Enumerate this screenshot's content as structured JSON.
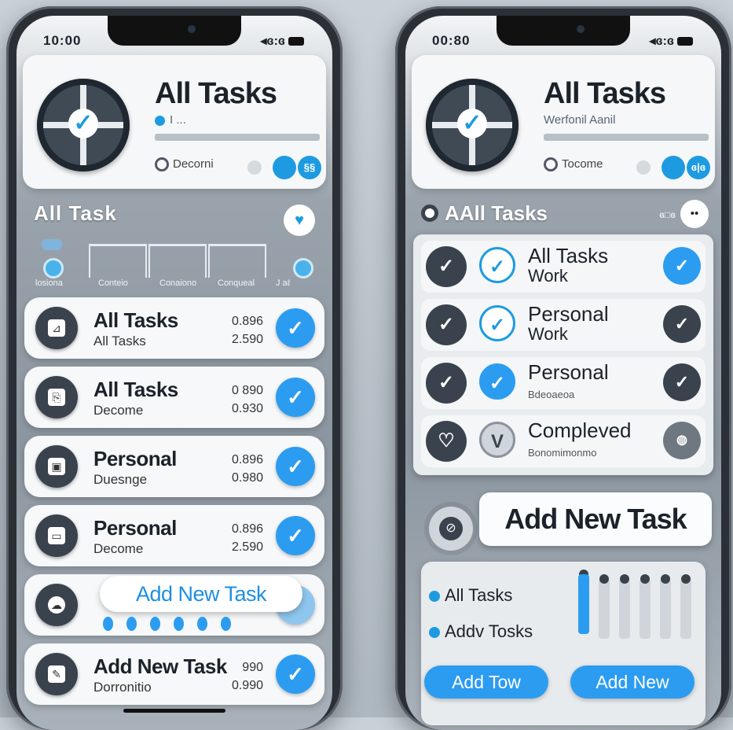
{
  "left": {
    "status": {
      "time": "10:00",
      "icons": "◂ɞ:ɞ"
    },
    "header": {
      "title": "All Tasks",
      "subtitle": "I ...",
      "chip": "Decorni",
      "btn1": "",
      "btn2": "§§"
    },
    "band": {
      "title": "All  Task",
      "labels": [
        "losiona",
        "Conteio",
        "Conaiono",
        "Conqueal",
        "J aℓ"
      ]
    },
    "rows": [
      {
        "title": "All Tasks",
        "sub": "All Tasks",
        "n1": "0.896",
        "n2": "2.590",
        "check": "✓"
      },
      {
        "title": "All Tasks",
        "sub": "Decome",
        "n1": "0 890",
        "n2": "0.930",
        "check": "✓"
      },
      {
        "title": "Personal",
        "sub": "Duesnge",
        "n1": "0.896",
        "n2": "0.980",
        "check": "✓"
      },
      {
        "title": "Personal",
        "sub": "Decome",
        "n1": "0.896",
        "n2": "2.590",
        "check": "✓"
      },
      {
        "title": "",
        "sub": "",
        "n1": "",
        "n2": "",
        "check": ""
      },
      {
        "title": "Add New Task",
        "sub": "Dorronitio",
        "n1": "990",
        "n2": "0.990",
        "check": "✓"
      }
    ],
    "add_pill": "Add New Task"
  },
  "right": {
    "status": {
      "time": "00:80",
      "icons": "◂ɞ:ɞ"
    },
    "header": {
      "title": "All Tasks",
      "subtitle": "Werfonil Aanil",
      "chip": "Tocome",
      "btn1": "",
      "btn2": "ɞ|ɞ"
    },
    "band_title": "AAll Tasks",
    "band_dots": "ɞ□ɞ",
    "rows": [
      {
        "l1": "All Tasks",
        "l2": "Work",
        "c2": "✓",
        "c3": "✓"
      },
      {
        "l1": "Personal",
        "l2": "Work",
        "c2": "✓",
        "c3": "✓"
      },
      {
        "l1": "Personal",
        "l2": "Bdeoaeoa",
        "c2": "✓",
        "c3": "✓"
      },
      {
        "l1": "Compleved",
        "l2": "Bonomimonmo",
        "c2": "V",
        "c3": "◍"
      }
    ],
    "add_pill": "Add New Task",
    "bottom_items": [
      "All Tasks",
      "Addv Tosks"
    ],
    "buttons": [
      "Add Tow",
      "Add New"
    ]
  }
}
